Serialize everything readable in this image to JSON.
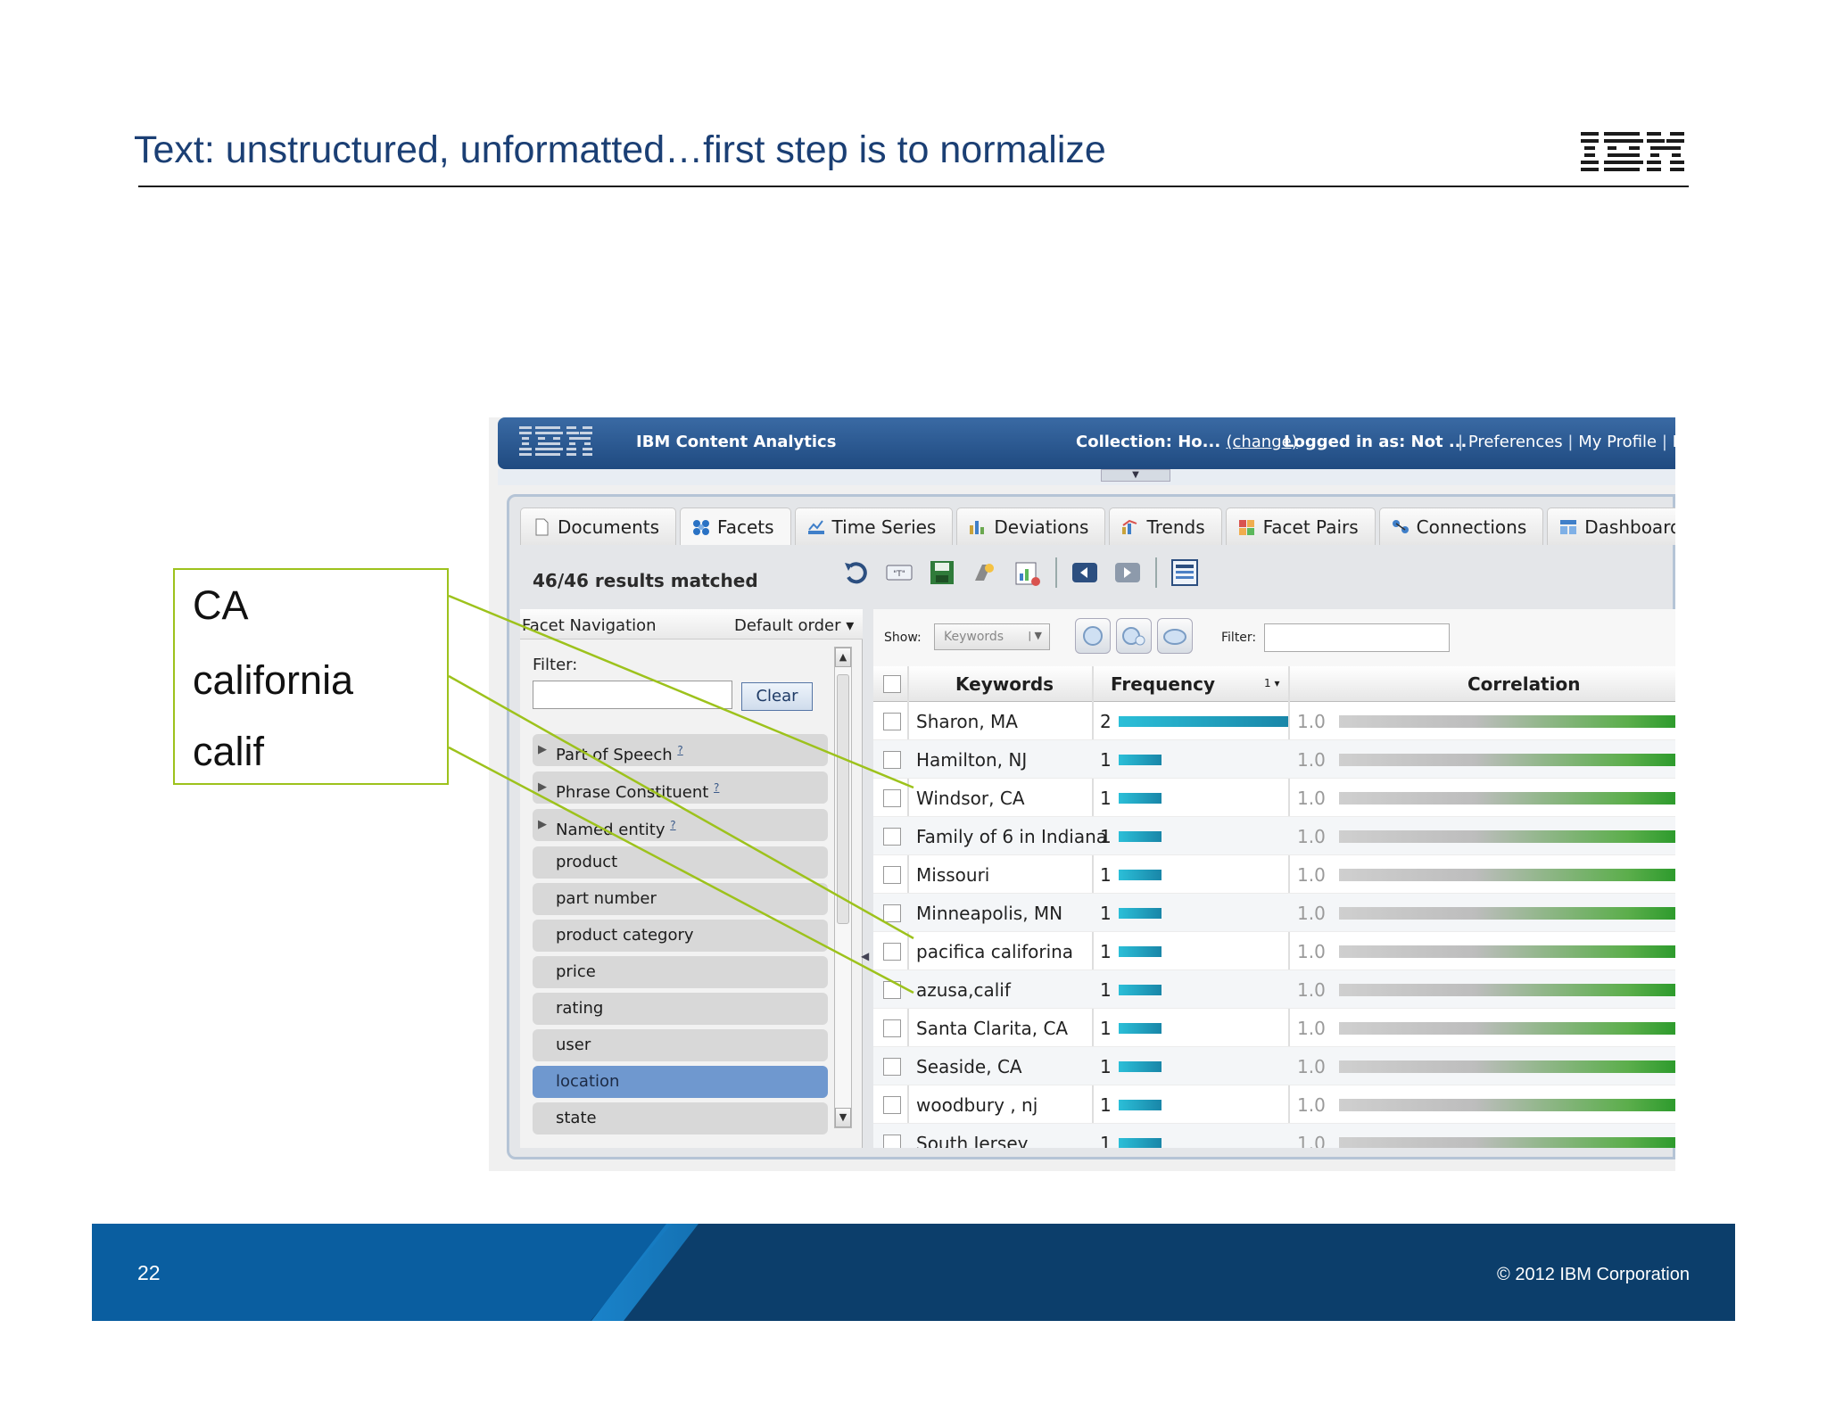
{
  "slide": {
    "title": "Text: unstructured, unformatted…first step is to normalize",
    "page_number": "22",
    "copyright": "© 2012 IBM Corporation",
    "logo": "IBM"
  },
  "callout": {
    "lines": [
      "CA",
      "california",
      "calif"
    ],
    "border_color": "#9dc21c"
  },
  "app": {
    "logo": "IBM",
    "name": "IBM Content Analytics",
    "collection_label": "Collection: Ho...",
    "collection_change": "(change)",
    "logged_in": "Logged in as: Not ...",
    "links": [
      "Preferences",
      "My Profile",
      "He"
    ],
    "tabs": [
      {
        "label": "Documents",
        "icon": "document-icon"
      },
      {
        "label": "Facets",
        "icon": "facets-icon"
      },
      {
        "label": "Time Series",
        "icon": "time-series-icon"
      },
      {
        "label": "Deviations",
        "icon": "deviations-icon"
      },
      {
        "label": "Trends",
        "icon": "trends-icon"
      },
      {
        "label": "Facet Pairs",
        "icon": "facet-pairs-icon"
      },
      {
        "label": "Connections",
        "icon": "connections-icon"
      },
      {
        "label": "Dashboard",
        "icon": "dashboard-icon"
      }
    ],
    "active_tab": "Facets",
    "results": "46/46 results matched",
    "toolbar_icons": [
      "undo-icon",
      "query-icon",
      "save-icon",
      "export-icon",
      "report-icon",
      "back-icon",
      "forward-icon",
      "layout-icon"
    ],
    "facet_nav": {
      "title": "Facet Navigation",
      "order": "Default order",
      "filter_label": "Filter:",
      "clear_label": "Clear",
      "items": [
        {
          "label": "Part of Speech",
          "help": "?",
          "expandable": true
        },
        {
          "label": "Phrase Constituent",
          "help": "?",
          "expandable": true
        },
        {
          "label": "Named entity",
          "help": "?",
          "expandable": true
        },
        {
          "label": "product"
        },
        {
          "label": "part number"
        },
        {
          "label": "product category"
        },
        {
          "label": "price"
        },
        {
          "label": "rating"
        },
        {
          "label": "user"
        },
        {
          "label": "location",
          "selected": true
        },
        {
          "label": "state"
        }
      ]
    },
    "keywords_panel": {
      "show_label": "Show:",
      "show_value": "Keywords",
      "filter_label": "Filter:",
      "columns": [
        "Keywords",
        "Frequency",
        "Correlation"
      ],
      "sort_indicator": "1 ▾",
      "rows": [
        {
          "keyword": "Sharon, MA",
          "frequency": 2,
          "correlation": "1.0"
        },
        {
          "keyword": "Hamilton, NJ",
          "frequency": 1,
          "correlation": "1.0"
        },
        {
          "keyword": "Windsor, CA",
          "frequency": 1,
          "correlation": "1.0"
        },
        {
          "keyword": "Family of 6 in Indiana",
          "frequency": 1,
          "correlation": "1.0"
        },
        {
          "keyword": "Missouri",
          "frequency": 1,
          "correlation": "1.0"
        },
        {
          "keyword": "Minneapolis, MN",
          "frequency": 1,
          "correlation": "1.0"
        },
        {
          "keyword": "pacifica califorina",
          "frequency": 1,
          "correlation": "1.0"
        },
        {
          "keyword": "azusa,calif",
          "frequency": 1,
          "correlation": "1.0"
        },
        {
          "keyword": "Santa Clarita, CA",
          "frequency": 1,
          "correlation": "1.0"
        },
        {
          "keyword": "Seaside, CA",
          "frequency": 1,
          "correlation": "1.0"
        },
        {
          "keyword": "woodbury , nj",
          "frequency": 1,
          "correlation": "1.0"
        },
        {
          "keyword": "South Jersey",
          "frequency": 1,
          "correlation": "1.0"
        }
      ]
    }
  }
}
